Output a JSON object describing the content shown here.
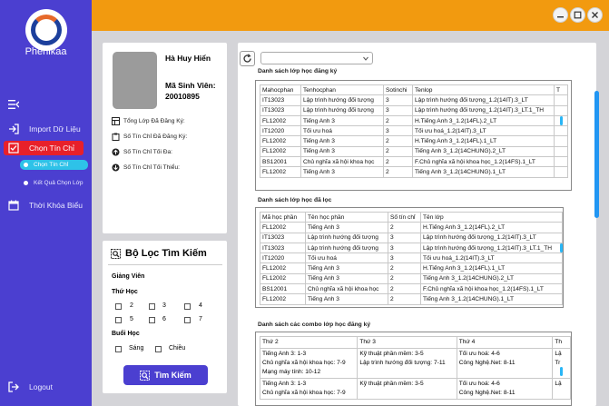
{
  "sidebar": {
    "brand": "Phenikaa",
    "items": [
      {
        "label": "Import Dữ Liệu"
      },
      {
        "label": "Chọn Tín Chỉ"
      },
      {
        "label": "Thời Khóa Biểu"
      },
      {
        "label": "Logout"
      }
    ],
    "sub_items": [
      {
        "label": "Chọn Tín Chỉ"
      },
      {
        "label": "Kết Quả Chọn Lớp"
      }
    ],
    "colors": {
      "background": "#4b3fd0",
      "active": "#e8202a",
      "sub_active": "#2ec2e8"
    }
  },
  "topbar": {
    "color": "#f29a0f",
    "buttons": [
      "minimize-icon",
      "maximize-icon",
      "close-icon"
    ]
  },
  "student": {
    "name": "Hà Huy Hiển",
    "msv_label": "Mã Sinh Viên:",
    "msv_value": "20010895",
    "stats": [
      {
        "label": "Tổng Lớp Đã Đăng Ký:",
        "icon": "table-icon"
      },
      {
        "label": "Số Tín Chỉ Đã Đăng Ký:",
        "icon": "clipboard-icon"
      },
      {
        "label": "Số Tín Chỉ Tối Đa:",
        "icon": "arrow-up-circle-icon"
      },
      {
        "label": "Số Tín Chỉ Tối Thiểu:",
        "icon": "arrow-down-circle-icon"
      }
    ]
  },
  "filter": {
    "title": "Bộ Lọc Tìm Kiếm",
    "giang_vien_label": "Giảng Viên",
    "thu_hoc_label": "Thứ Học",
    "days": [
      "2",
      "3",
      "4",
      "5",
      "6",
      "7"
    ],
    "buoi_hoc_label": "Buổi Học",
    "sessions": [
      "Sáng",
      "Chiều"
    ],
    "search_button": "Tìm Kiếm"
  },
  "main": {
    "dropdown_value": "",
    "registered": {
      "title": "Danh sách lớp học đăng ký",
      "columns": [
        "Mahocphan",
        "Tenhocphan",
        "Sotinchi",
        "Tenlop",
        "T"
      ],
      "rows": [
        [
          "IT13023",
          "Lập trình hướng đối tượng",
          "3",
          "Lập trình hướng đối tượng_1.2(14IT).3_LT",
          ""
        ],
        [
          "IT13023",
          "Lập trình hướng đối tượng",
          "3",
          "Lập trình hướng đối tượng_1.2(14IT).3_LT.1_TH",
          ""
        ],
        [
          "FL12002",
          "Tiếng Anh 3",
          "2",
          "H.Tiếng Anh 3_1.2(14FL).2_LT",
          ""
        ],
        [
          "IT12020",
          "Tối ưu hoá",
          "3",
          "Tối ưu hoá_1.2(14IT).3_LT",
          ""
        ],
        [
          "FL12002",
          "Tiếng Anh 3",
          "2",
          "H.Tiếng Anh 3_1.2(14FL).1_LT",
          ""
        ],
        [
          "FL12002",
          "Tiếng Anh 3",
          "2",
          "Tiếng Anh 3_1.2(14CHUNG).2_LT",
          ""
        ],
        [
          "BS12001",
          "Chủ nghĩa xã hội khoa học",
          "2",
          "F.Chủ nghĩa xã hội khoa học_1.2(14FS).1_LT",
          ""
        ],
        [
          "FL12002",
          "Tiếng Anh 3",
          "2",
          "Tiếng Anh 3_1.2(14CHUNG).1_LT",
          ""
        ]
      ]
    },
    "filtered": {
      "title": "Danh sách lớp học đã lọc",
      "columns": [
        "Mã học phần",
        "Tên học phần",
        "Số tín chỉ",
        "Tên lớp"
      ],
      "rows": [
        [
          "FL12002",
          "Tiếng Anh 3",
          "2",
          "H.Tiếng Anh 3_1.2(14FL).2_LT"
        ],
        [
          "IT13023",
          "Lập trình hướng đối tượng",
          "3",
          "Lập trình hướng đối tượng_1.2(14IT).3_LT"
        ],
        [
          "IT13023",
          "Lập trình hướng đối tượng",
          "3",
          "Lập trình hướng đối tượng_1.2(14IT).3_LT.1_TH"
        ],
        [
          "IT12020",
          "Tối ưu hoá",
          "3",
          "Tối ưu hoá_1.2(14IT).3_LT"
        ],
        [
          "FL12002",
          "Tiếng Anh 3",
          "2",
          "H.Tiếng Anh 3_1.2(14FL).1_LT"
        ],
        [
          "FL12002",
          "Tiếng Anh 3",
          "2",
          "Tiếng Anh 3_1.2(14CHUNG).2_LT"
        ],
        [
          "BS12001",
          "Chủ nghĩa xã hội khoa học",
          "2",
          "F.Chủ nghĩa xã hội khoa học_1.2(14FS).1_LT"
        ],
        [
          "FL12002",
          "Tiếng Anh 3",
          "2",
          "Tiếng Anh 3_1.2(14CHUNG).1_LT"
        ]
      ]
    },
    "combos": {
      "title": "Danh sách các combo lớp học đăng ký",
      "columns": [
        "Thứ 2",
        "Thứ 3",
        "Thứ 4",
        "Th"
      ],
      "rows": [
        [
          [
            "Tiếng Anh 3: 1-3",
            "Chủ nghĩa xã hội khoa học: 7-9",
            "Mạng máy tính: 10-12"
          ],
          [
            "Kỹ thuật phần mềm: 3-5",
            "Lập trình hướng đối tượng: 7-11"
          ],
          [
            "Tối ưu hoá: 4-6",
            "Công Nghệ.Net: 8-11"
          ],
          [
            "Lậ",
            "Tr"
          ]
        ],
        [
          [
            "Tiếng Anh 3: 1-3",
            "Chủ nghĩa xã hội khoa học: 7-9"
          ],
          [
            "Kỹ thuật phần mềm: 3-5"
          ],
          [
            "Tối ưu hoá: 4-6",
            "Công Nghệ.Net: 8-11"
          ],
          [
            "Lậ"
          ]
        ]
      ]
    }
  }
}
